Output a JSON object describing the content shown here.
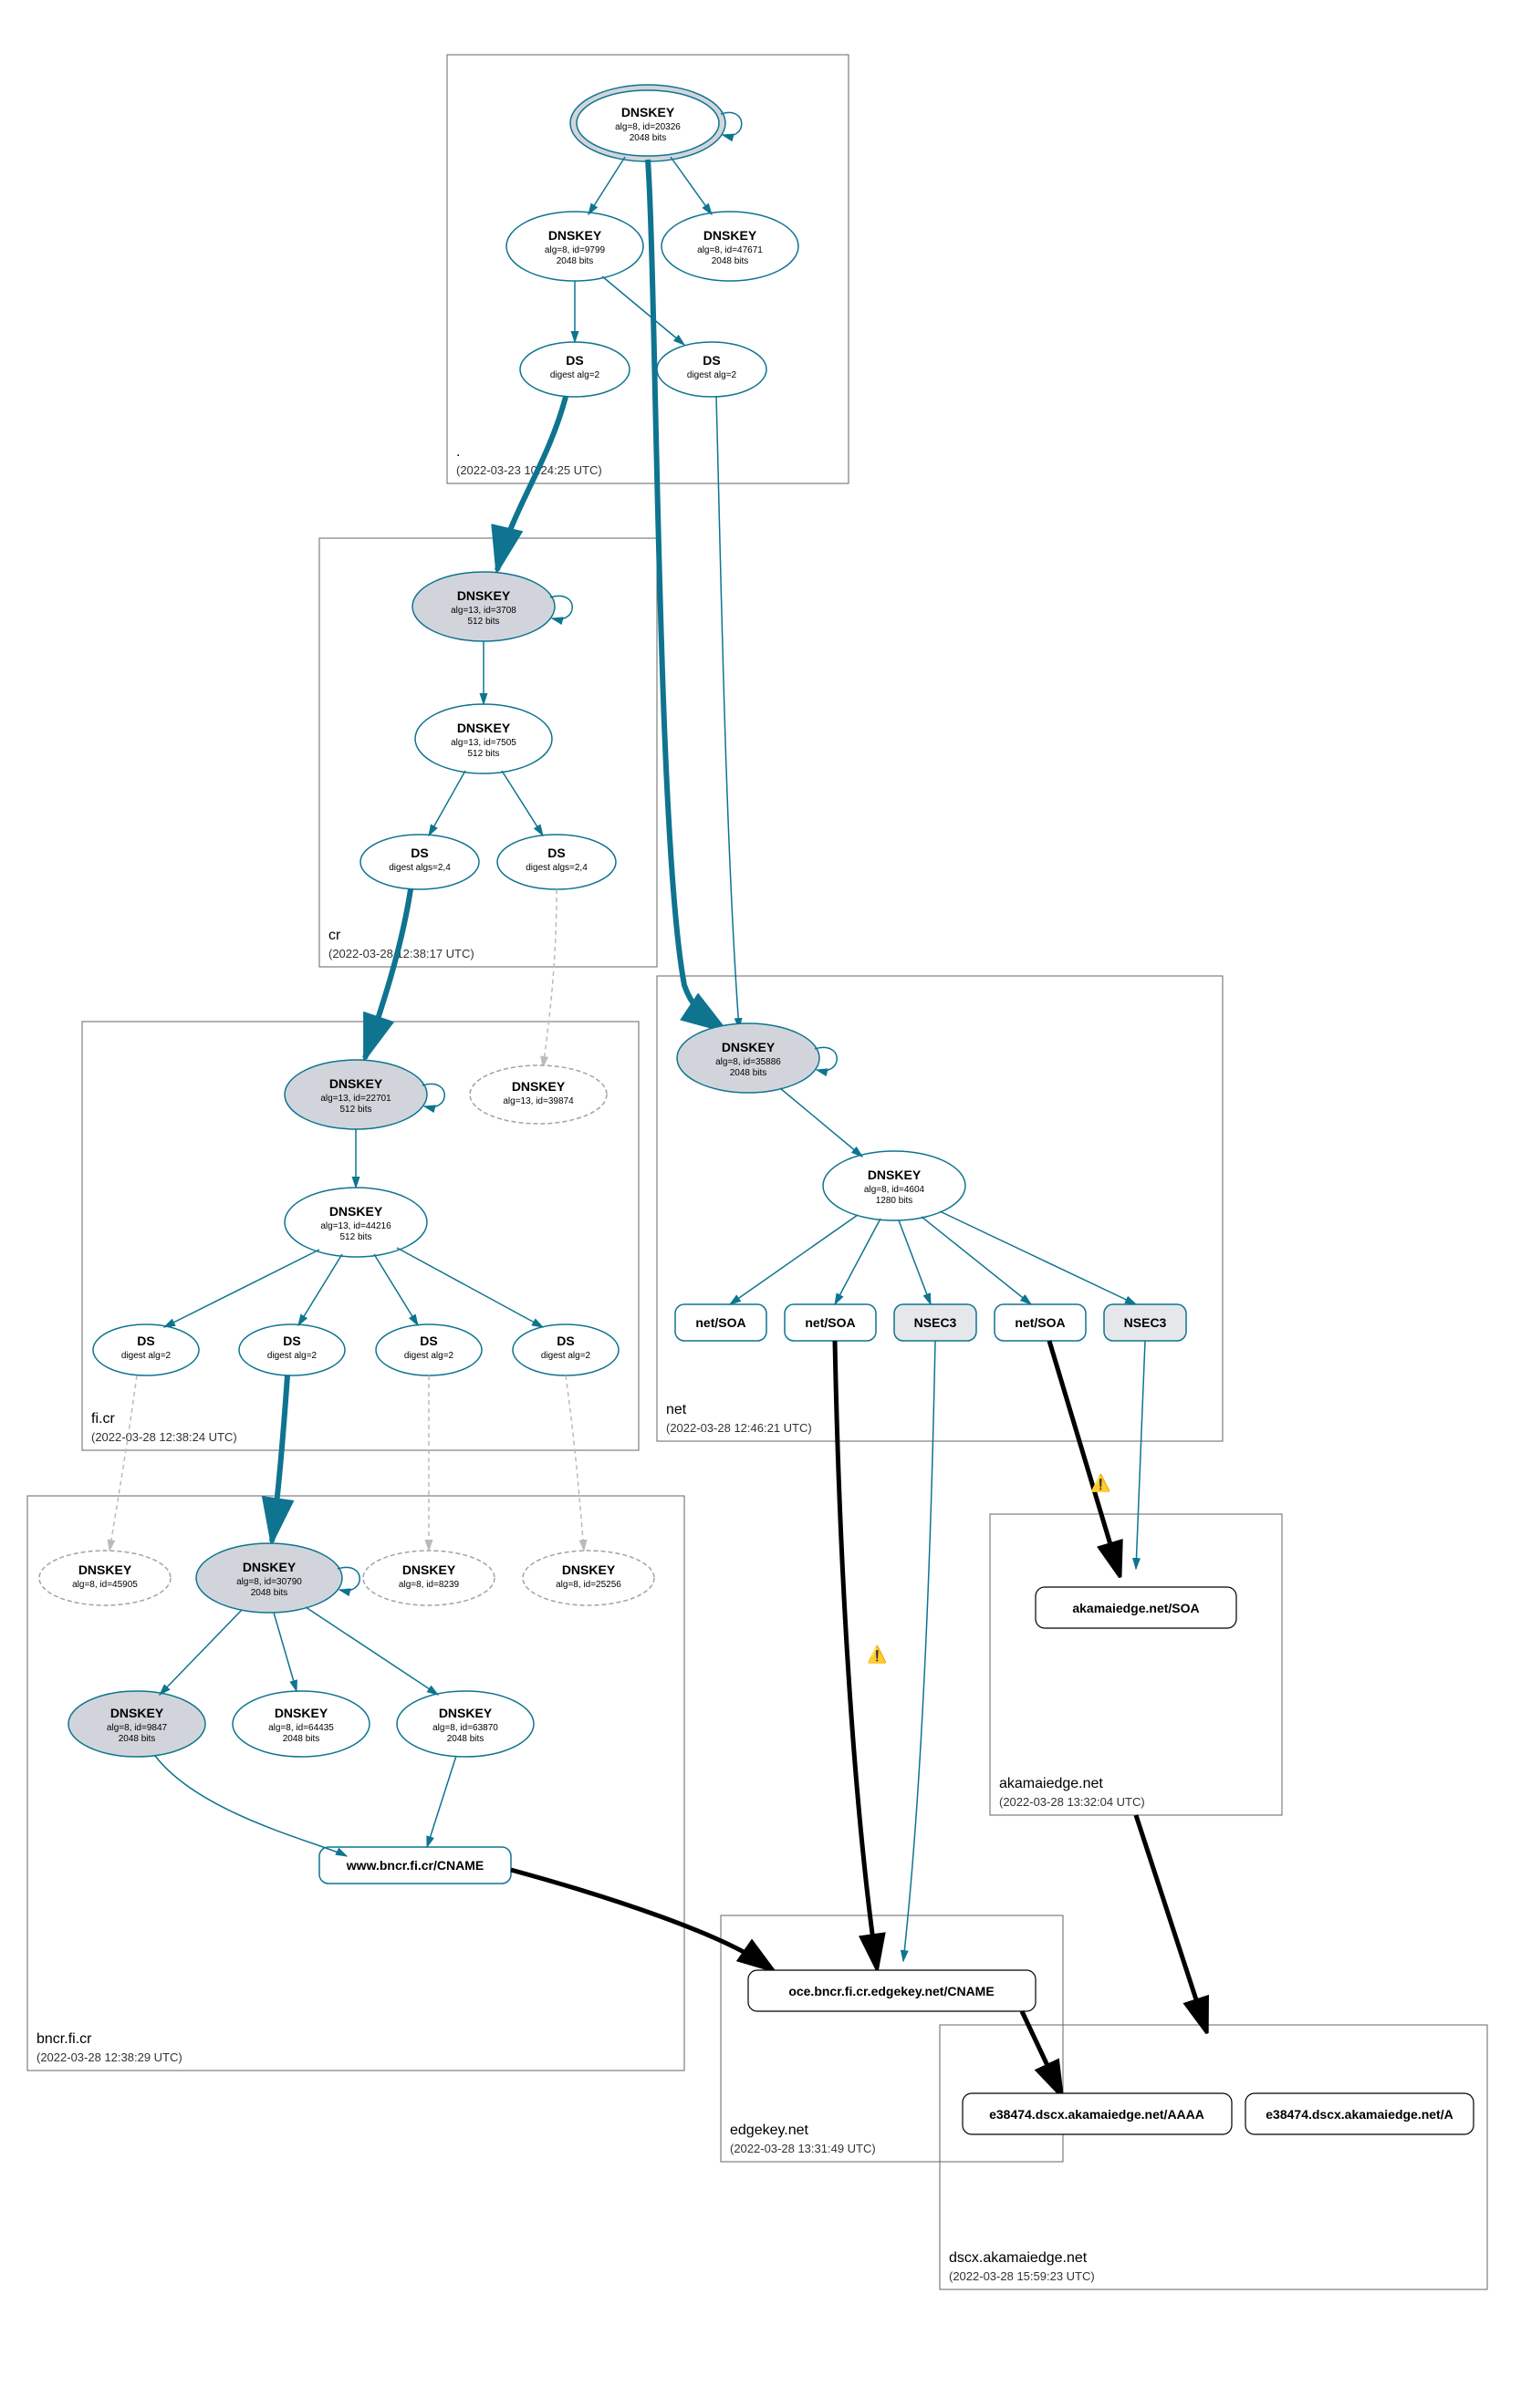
{
  "zones": {
    "root": {
      "name": ".",
      "ts": "(2022-03-23 10:24:25 UTC)"
    },
    "cr": {
      "name": "cr",
      "ts": "(2022-03-28 12:38:17 UTC)"
    },
    "ficr": {
      "name": "fi.cr",
      "ts": "(2022-03-28 12:38:24 UTC)"
    },
    "bncr": {
      "name": "bncr.fi.cr",
      "ts": "(2022-03-28 12:38:29 UTC)"
    },
    "net": {
      "name": "net",
      "ts": "(2022-03-28 12:46:21 UTC)"
    },
    "akamai": {
      "name": "akamaiedge.net",
      "ts": "(2022-03-28 13:32:04 UTC)"
    },
    "edgekey": {
      "name": "edgekey.net",
      "ts": "(2022-03-28 13:31:49 UTC)"
    },
    "dscx": {
      "name": "dscx.akamaiedge.net",
      "ts": "(2022-03-28 15:59:23 UTC)"
    }
  },
  "nodes": {
    "root_ksk": {
      "t": "DNSKEY",
      "s": "alg=8, id=20326",
      "s2": "2048 bits"
    },
    "root_zsk1": {
      "t": "DNSKEY",
      "s": "alg=8, id=9799",
      "s2": "2048 bits"
    },
    "root_zsk2": {
      "t": "DNSKEY",
      "s": "alg=8, id=47671",
      "s2": "2048 bits"
    },
    "root_ds1": {
      "t": "DS",
      "s": "digest alg=2"
    },
    "root_ds2": {
      "t": "DS",
      "s": "digest alg=2"
    },
    "cr_ksk": {
      "t": "DNSKEY",
      "s": "alg=13, id=3708",
      "s2": "512 bits"
    },
    "cr_zsk": {
      "t": "DNSKEY",
      "s": "alg=13, id=7505",
      "s2": "512 bits"
    },
    "cr_ds1": {
      "t": "DS",
      "s": "digest algs=2,4"
    },
    "cr_ds2": {
      "t": "DS",
      "s": "digest algs=2,4"
    },
    "ficr_ksk": {
      "t": "DNSKEY",
      "s": "alg=13, id=22701",
      "s2": "512 bits"
    },
    "ficr_d1": {
      "t": "DNSKEY",
      "s": "alg=13, id=39874"
    },
    "ficr_zsk": {
      "t": "DNSKEY",
      "s": "alg=13, id=44216",
      "s2": "512 bits"
    },
    "ficr_ds1": {
      "t": "DS",
      "s": "digest alg=2"
    },
    "ficr_ds2": {
      "t": "DS",
      "s": "digest alg=2"
    },
    "ficr_ds3": {
      "t": "DS",
      "s": "digest alg=2"
    },
    "ficr_ds4": {
      "t": "DS",
      "s": "digest alg=2"
    },
    "bncr_d1": {
      "t": "DNSKEY",
      "s": "alg=8, id=45905"
    },
    "bncr_ksk": {
      "t": "DNSKEY",
      "s": "alg=8, id=30790",
      "s2": "2048 bits"
    },
    "bncr_d2": {
      "t": "DNSKEY",
      "s": "alg=8, id=8239"
    },
    "bncr_d3": {
      "t": "DNSKEY",
      "s": "alg=8, id=25256"
    },
    "bncr_z1": {
      "t": "DNSKEY",
      "s": "alg=8, id=9847",
      "s2": "2048 bits"
    },
    "bncr_z2": {
      "t": "DNSKEY",
      "s": "alg=8, id=64435",
      "s2": "2048 bits"
    },
    "bncr_z3": {
      "t": "DNSKEY",
      "s": "alg=8, id=63870",
      "s2": "2048 bits"
    },
    "bncr_cname": {
      "t": "www.bncr.fi.cr/CNAME"
    },
    "net_ksk": {
      "t": "DNSKEY",
      "s": "alg=8, id=35886",
      "s2": "2048 bits"
    },
    "net_zsk": {
      "t": "DNSKEY",
      "s": "alg=8, id=4604",
      "s2": "1280 bits"
    },
    "net_soa1": {
      "t": "net/SOA"
    },
    "net_soa2": {
      "t": "net/SOA"
    },
    "net_nsec1": {
      "t": "NSEC3"
    },
    "net_soa3": {
      "t": "net/SOA"
    },
    "net_nsec2": {
      "t": "NSEC3"
    },
    "akamai_soa": {
      "t": "akamaiedge.net/SOA"
    },
    "edgekey_cname": {
      "t": "oce.bncr.fi.cr.edgekey.net/CNAME"
    },
    "dscx_aaaa": {
      "t": "e38474.dscx.akamaiedge.net/AAAA"
    },
    "dscx_a": {
      "t": "e38474.dscx.akamaiedge.net/A"
    }
  }
}
